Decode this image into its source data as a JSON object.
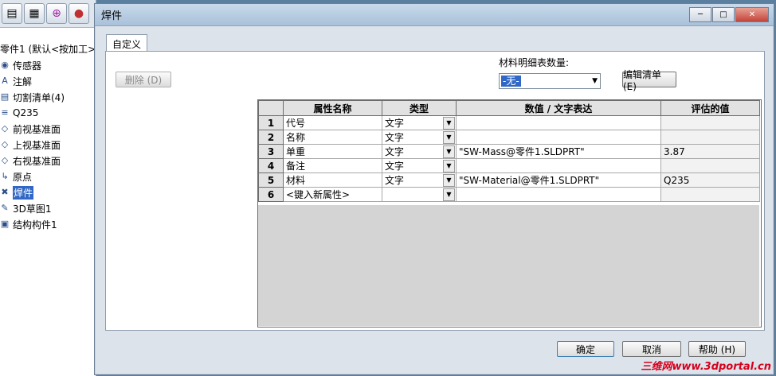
{
  "tree": {
    "toolbar_icons": [
      "properties-icon",
      "config-icon",
      "origin-icon",
      "appearance-icon"
    ],
    "root": "零件1 (默认<按加工>",
    "items": [
      {
        "label": "传感器",
        "icon": "sensor-icon"
      },
      {
        "label": "注解",
        "icon": "annotation-icon"
      },
      {
        "label": "切割清单(4)",
        "icon": "cut-list-icon"
      },
      {
        "label": "Q235",
        "icon": "material-icon"
      },
      {
        "label": "前视基准面",
        "icon": "plane-icon"
      },
      {
        "label": "上视基准面",
        "icon": "plane-icon"
      },
      {
        "label": "右视基准面",
        "icon": "plane-icon"
      },
      {
        "label": "原点",
        "icon": "origin-icon"
      },
      {
        "label": "焊件",
        "icon": "weldment-icon",
        "selected": true
      },
      {
        "label": "3D草图1",
        "icon": "sketch-icon"
      },
      {
        "label": "结构构件1",
        "icon": "structural-member-icon"
      }
    ]
  },
  "dialog": {
    "title": "焊件",
    "tab": "自定义",
    "delete_button": "删除 (D)",
    "bom_quantity_label": "材料明细表数量:",
    "bom_quantity_value": "-无-",
    "edit_list_button": "编辑清单 (E)",
    "ok_button": "确定",
    "cancel_button": "取消",
    "help_button": "帮助 (H)"
  },
  "grid": {
    "columns": [
      "属性名称",
      "类型",
      "数值 / 文字表达",
      "评估的值"
    ],
    "rows": [
      {
        "num": "1",
        "name": "代号",
        "type": "文字",
        "value": "",
        "evaluated": ""
      },
      {
        "num": "2",
        "name": "名称",
        "type": "文字",
        "value": "",
        "evaluated": ""
      },
      {
        "num": "3",
        "name": "单重",
        "type": "文字",
        "value": "\"SW-Mass@零件1.SLDPRT\"",
        "evaluated": "3.87"
      },
      {
        "num": "4",
        "name": "备注",
        "type": "文字",
        "value": "",
        "evaluated": ""
      },
      {
        "num": "5",
        "name": "材料",
        "type": "文字",
        "value": "\"SW-Material@零件1.SLDPRT\"",
        "evaluated": "Q235"
      },
      {
        "num": "6",
        "name": "<键入新属性>",
        "type": "",
        "value": "",
        "evaluated": ""
      }
    ]
  },
  "watermark": "三维网www.3dportal.cn"
}
